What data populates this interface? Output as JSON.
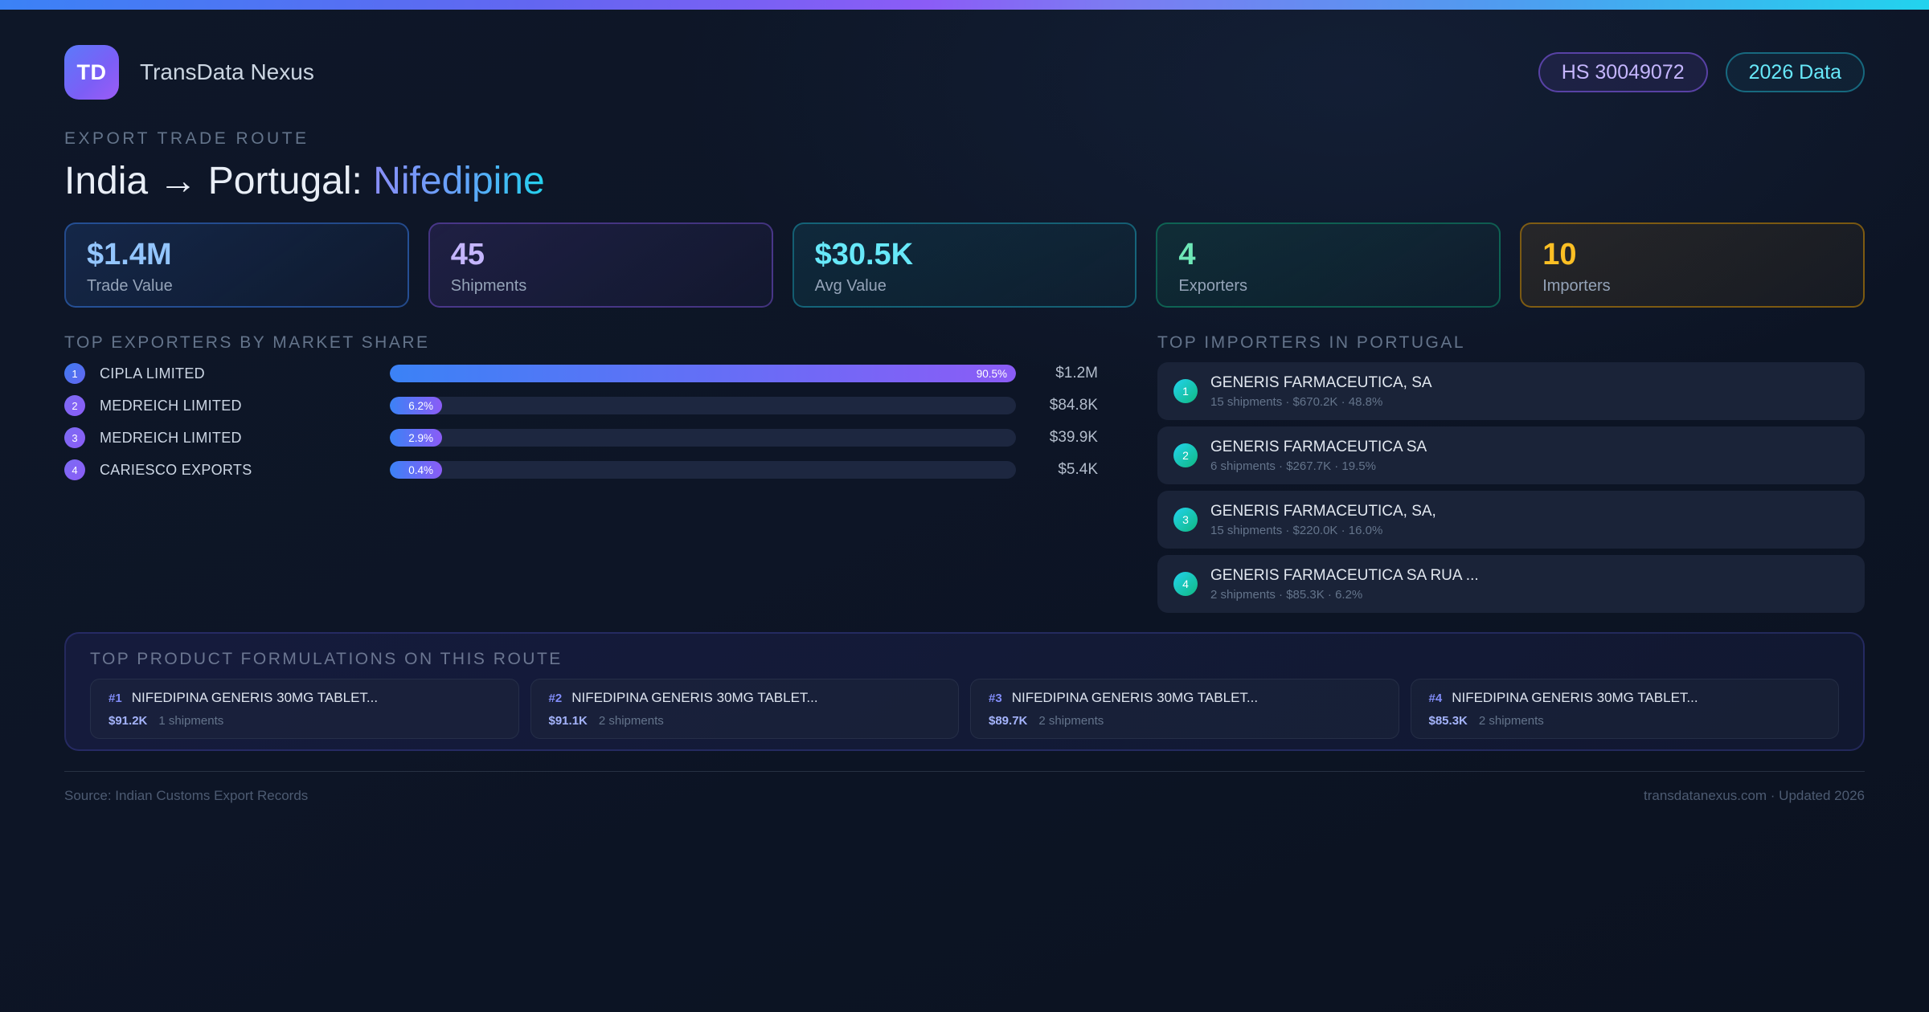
{
  "brand": {
    "logo_text": "TD",
    "name": "TransData Nexus"
  },
  "header_badges": {
    "hs_code": "HS 30049072",
    "year": "2026 Data"
  },
  "hero": {
    "eyebrow": "EXPORT TRADE ROUTE",
    "title_prefix": "India → Portugal: ",
    "title_highlight": "Nifedipine"
  },
  "stats": [
    {
      "value": "$1.4M",
      "label": "Trade Value",
      "accent": "#93c5fd",
      "border": "rgba(59,130,246,0.45)",
      "bg": "linear-gradient(145deg, rgba(59,130,246,0.16), rgba(59,130,246,0.04))"
    },
    {
      "value": "45",
      "label": "Shipments",
      "accent": "#c4b5fd",
      "border": "rgba(139,92,246,0.40)",
      "bg": "linear-gradient(145deg, rgba(139,92,246,0.14), rgba(139,92,246,0.04))"
    },
    {
      "value": "$30.5K",
      "label": "Avg Value",
      "accent": "#67e8f9",
      "border": "rgba(34,211,238,0.35)",
      "bg": "linear-gradient(145deg, rgba(34,211,238,0.10), rgba(13,148,136,0.06))"
    },
    {
      "value": "4",
      "label": "Exporters",
      "accent": "#6ee7b7",
      "border": "rgba(16,185,129,0.40)",
      "bg": "linear-gradient(145deg, rgba(16,185,129,0.12), rgba(16,185,129,0.03))"
    },
    {
      "value": "10",
      "label": "Importers",
      "accent": "#fbbf24",
      "border": "rgba(202,138,4,0.55)",
      "bg": "linear-gradient(145deg, rgba(245,158,11,0.10), rgba(120,90,20,0.10))"
    }
  ],
  "exporters": {
    "heading": "TOP EXPORTERS BY MARKET SHARE",
    "rows": [
      {
        "rank": "1",
        "name": "CIPLA LIMITED",
        "share": 90.5,
        "share_label": "90.5%",
        "value": "$1.2M"
      },
      {
        "rank": "2",
        "name": "MEDREICH LIMITED",
        "share": 6.2,
        "share_label": "6.2%",
        "value": "$84.8K"
      },
      {
        "rank": "3",
        "name": "MEDREICH LIMITED",
        "share": 2.9,
        "share_label": "2.9%",
        "value": "$39.9K"
      },
      {
        "rank": "4",
        "name": "CARIESCO EXPORTS",
        "share": 0.4,
        "share_label": "0.4%",
        "value": "$5.4K"
      }
    ]
  },
  "importers": {
    "heading": "TOP IMPORTERS IN PORTUGAL",
    "rows": [
      {
        "rank": "1",
        "name": "GENERIS FARMACEUTICA, SA",
        "meta": "15 shipments · $670.2K · 48.8%"
      },
      {
        "rank": "2",
        "name": "GENERIS FARMACEUTICA SA",
        "meta": "6 shipments · $267.7K · 19.5%"
      },
      {
        "rank": "3",
        "name": "GENERIS FARMACEUTICA, SA,",
        "meta": "15 shipments · $220.0K · 16.0%"
      },
      {
        "rank": "4",
        "name": "GENERIS FARMACEUTICA SA RUA ...",
        "meta": "2 shipments · $85.3K · 6.2%"
      }
    ]
  },
  "products": {
    "heading": "TOP PRODUCT FORMULATIONS ON THIS ROUTE",
    "items": [
      {
        "rank": "#1",
        "name": "NIFEDIPINA GENERIS 30MG TABLET...",
        "value": "$91.2K",
        "shipments": "1 shipments"
      },
      {
        "rank": "#2",
        "name": "NIFEDIPINA GENERIS 30MG TABLET...",
        "value": "$91.1K",
        "shipments": "2 shipments"
      },
      {
        "rank": "#3",
        "name": "NIFEDIPINA GENERIS 30MG TABLET...",
        "value": "$89.7K",
        "shipments": "2 shipments"
      },
      {
        "rank": "#4",
        "name": "NIFEDIPINA GENERIS 30MG TABLET...",
        "value": "$85.3K",
        "shipments": "2 shipments"
      }
    ]
  },
  "footer": {
    "source": "Source: Indian Customs Export Records",
    "site_info": "transdatanexus.com · Updated 2026"
  }
}
